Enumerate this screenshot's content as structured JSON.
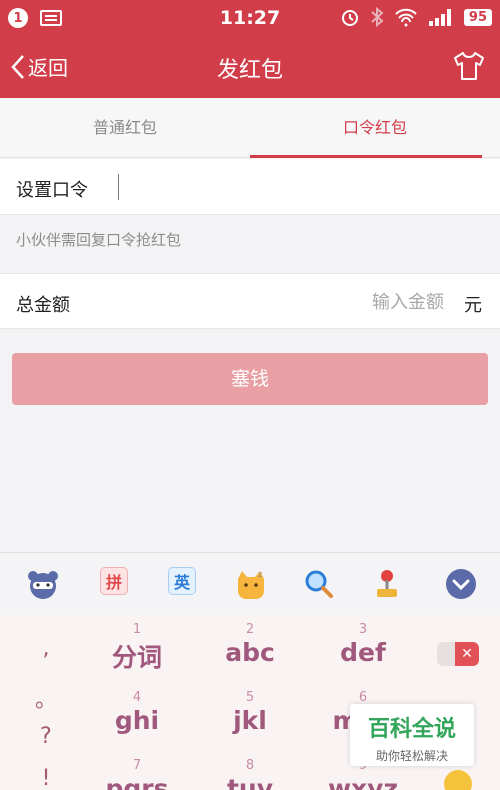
{
  "status": {
    "notification_count": "1",
    "time": "11:27",
    "battery": "95"
  },
  "header": {
    "back_label": "返回",
    "title": "发红包"
  },
  "tabs": [
    {
      "label": "普通红包",
      "active": false
    },
    {
      "label": "口令红包",
      "active": true
    }
  ],
  "form": {
    "code_label": "设置口令",
    "hint": "小伙伴需回复口令抢红包",
    "amount_label": "总金额",
    "amount_placeholder": "输入金额",
    "unit": "元",
    "submit_label": "塞钱"
  },
  "keyboard": {
    "toolbar": {
      "pinyin_label": "拼",
      "english_label": "英"
    },
    "punct": [
      ",",
      "。",
      "?",
      "!"
    ],
    "keys": [
      {
        "num": "1",
        "text": "分词"
      },
      {
        "num": "2",
        "text": "abc"
      },
      {
        "num": "3",
        "text": "def"
      },
      {
        "num": "4",
        "text": "ghi"
      },
      {
        "num": "5",
        "text": "jkl"
      },
      {
        "num": "6",
        "text": "mno"
      },
      {
        "num": "7",
        "text": "pqrs"
      },
      {
        "num": "8",
        "text": "tuv"
      },
      {
        "num": "9",
        "text": "wxyz"
      }
    ]
  },
  "watermark": {
    "title": "百科全说",
    "subtitle": "助你轻松解决"
  },
  "colors": {
    "brand": "#d23d4a",
    "button_disabled": "#e8a0a4"
  }
}
